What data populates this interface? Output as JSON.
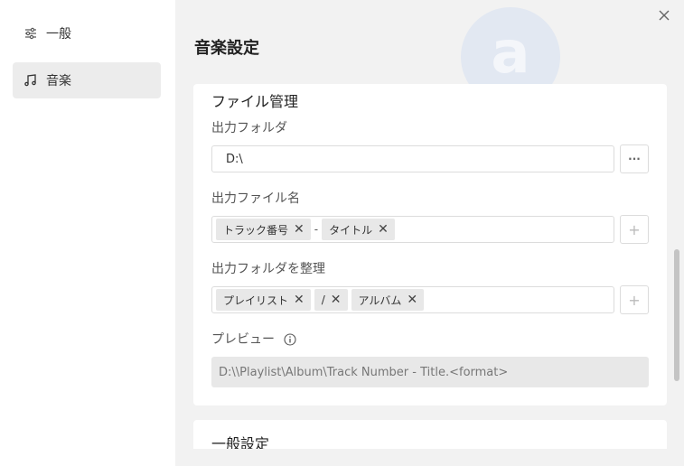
{
  "sidebar": {
    "items": [
      {
        "label": "一般",
        "icon": "sliders-icon"
      },
      {
        "label": "音楽",
        "icon": "music-note-icon"
      }
    ]
  },
  "header": {
    "title": "音楽設定",
    "watermark_letter": "a"
  },
  "file_management": {
    "title": "ファイル管理",
    "output_folder": {
      "label": "出力フォルダ",
      "value": "D:\\",
      "browse_label": "···"
    },
    "output_filename": {
      "label": "出力ファイル名",
      "tags": [
        "トラック番号",
        "タイトル"
      ],
      "separator": "-",
      "add_label": "+"
    },
    "organize_folder": {
      "label": "出力フォルダを整理",
      "tags": [
        "プレイリスト",
        "/",
        "アルバム"
      ],
      "add_label": "+"
    },
    "preview": {
      "label": "プレビュー",
      "value": "D:\\\\Playlist\\Album\\Track Number - Title.<format>"
    }
  },
  "general_settings": {
    "title": "一般設定"
  },
  "colors": {
    "sidebar_active": "#ececec",
    "main_bg": "#f2f2f2",
    "tag_bg": "#e8e8e8"
  }
}
